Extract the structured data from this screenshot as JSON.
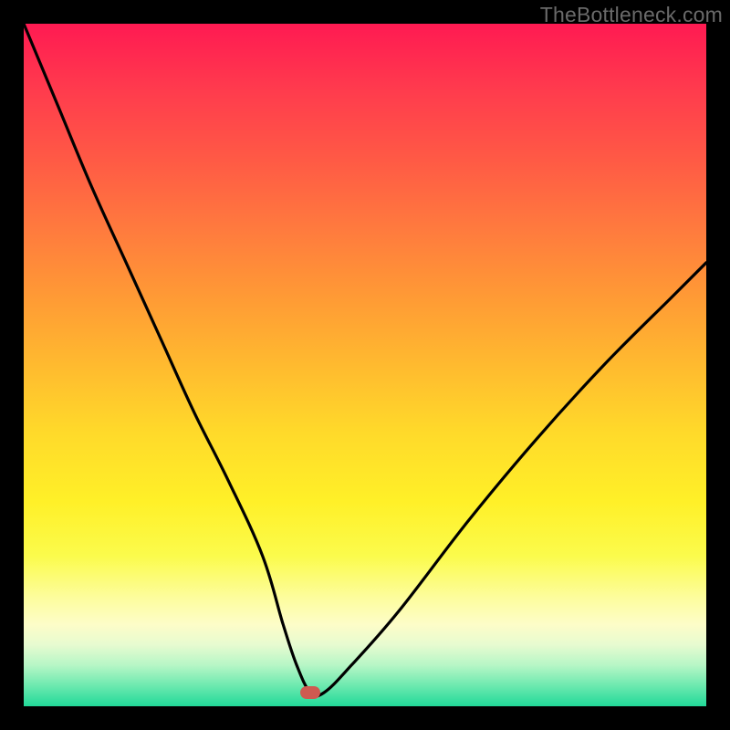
{
  "watermark": "TheBottleneck.com",
  "colors": {
    "frame": "#000000",
    "curve": "#000000",
    "marker": "#cf5a51"
  },
  "chart_data": {
    "type": "line",
    "title": "",
    "xlabel": "",
    "ylabel": "",
    "xlim": [
      0,
      100
    ],
    "ylim": [
      0,
      100
    ],
    "grid": false,
    "marker": {
      "x": 42,
      "y": 2,
      "shape": "rounded-rect"
    },
    "series": [
      {
        "name": "bottleneck-curve",
        "x": [
          0,
          5,
          10,
          15,
          20,
          25,
          30,
          35,
          38,
          40,
          42,
          44,
          48,
          55,
          65,
          75,
          85,
          95,
          100
        ],
        "values": [
          100,
          88,
          76,
          65,
          54,
          43,
          33,
          22,
          12,
          6,
          2,
          2,
          6,
          14,
          27,
          39,
          50,
          60,
          65
        ]
      }
    ],
    "gradient_stops": [
      {
        "pos": 0,
        "color": "#ff1a52"
      },
      {
        "pos": 50,
        "color": "#ffba2f"
      },
      {
        "pos": 78,
        "color": "#fbfb4c"
      },
      {
        "pos": 100,
        "color": "#21d999"
      }
    ]
  }
}
